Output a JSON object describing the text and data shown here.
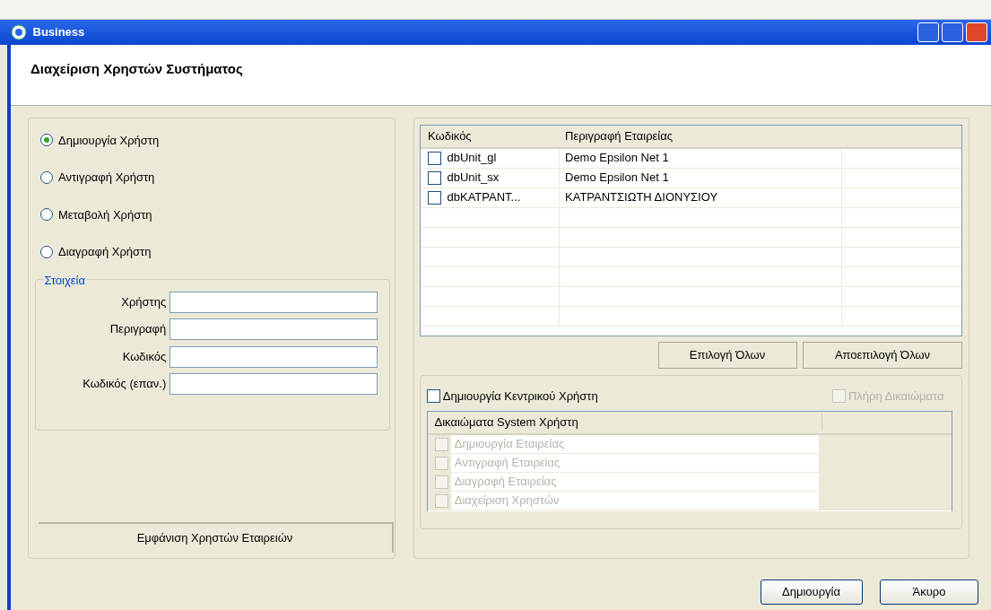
{
  "window": {
    "title": "Business"
  },
  "header": {
    "title": "Διαχείριση Χρηστών Συστήματος"
  },
  "modes": [
    {
      "label": "Δημιουργία Χρήστη",
      "selected": true
    },
    {
      "label": "Αντιγραφή Χρήστη",
      "selected": false
    },
    {
      "label": "Μεταβολή Χρήστη",
      "selected": false
    },
    {
      "label": "Διαγραφή Χρήστη",
      "selected": false
    }
  ],
  "details": {
    "legend": "Στοιχεία",
    "fields": [
      {
        "label": "Χρήστης"
      },
      {
        "label": "Περιγραφή"
      },
      {
        "label": "Κωδικός"
      },
      {
        "label": "Κωδικός (επαν.)"
      }
    ]
  },
  "show_users_button": "Εμφάνιση Χρηστών Εταιρειών",
  "companies": {
    "columns": [
      "Κωδικός",
      "Περιγραφή Εταιρείας"
    ],
    "rows": [
      {
        "code": "dbUnit_gl",
        "description": "Demo Epsilon Net 1",
        "checked": false
      },
      {
        "code": "dbUnit_sx",
        "description": "Demo Epsilon Net 1",
        "checked": false
      },
      {
        "code": "dbΚΑΤΡΑΝΤ...",
        "description": "ΚΑΤΡΑΝΤΣΙΩΤΗ ΔΙΟΝΥΣΙΟΥ",
        "checked": false
      }
    ]
  },
  "select_all": "Επιλογή Όλων",
  "deselect_all": "Αποεπιλογή Όλων",
  "central_user": {
    "label": "Δημιουργία Κεντρικού Χρήστη",
    "checked": false
  },
  "full_rights": {
    "label": "Πλήρη Δικαιώματα",
    "checked": false,
    "disabled": true
  },
  "rights": {
    "column": "Δικαιώματα System Χρήστη",
    "items": [
      {
        "label": "Δημιουργία Εταιρείας",
        "checked": false,
        "disabled": true
      },
      {
        "label": "Αντιγραφή Εταιρείας",
        "checked": false,
        "disabled": true
      },
      {
        "label": "Διαγραφή Εταιρείας",
        "checked": false,
        "disabled": true
      },
      {
        "label": "Διαχείριση Χρηστών",
        "checked": false,
        "disabled": true
      }
    ]
  },
  "buttons": [
    "Δημιουργία",
    "Άκυρο"
  ]
}
